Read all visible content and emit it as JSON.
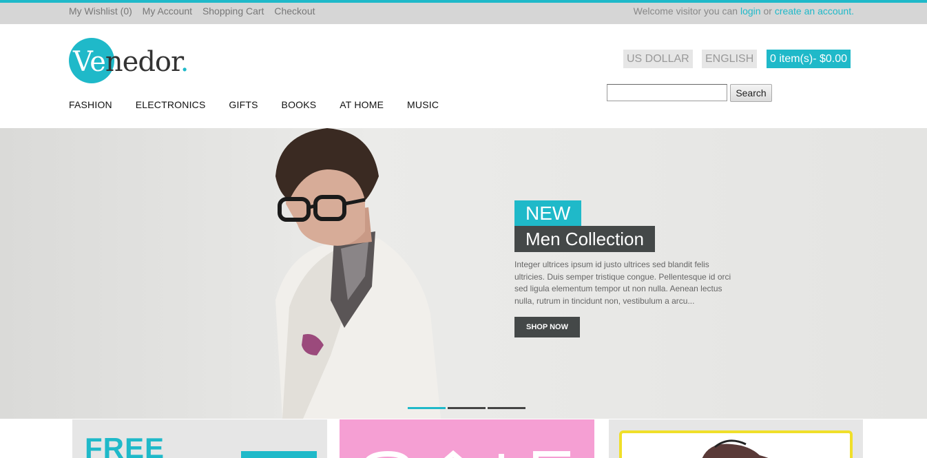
{
  "topbar": {
    "links": [
      "My Wishlist (0)",
      "My Account",
      "Shopping Cart",
      "Checkout"
    ],
    "welcome_prefix": "Welcome visitor you can ",
    "login_label": "login",
    "or_label": " or ",
    "create_label": "create an account."
  },
  "header": {
    "logo": {
      "ve": "Ve",
      "rest": "nedor",
      "dot": "."
    },
    "nav": [
      "FASHION",
      "ELECTRONICS",
      "GIFTS",
      "BOOKS",
      "AT HOME",
      "MUSIC"
    ],
    "currency": "US DOLLAR",
    "language": "ENGLISH",
    "cart": "0 item(s)- $0.00",
    "search": {
      "value": "",
      "button": "Search"
    }
  },
  "hero": {
    "badge": "NEW",
    "title": "Men Collection",
    "description": "Integer ultrices ipsum id justo ultrices sed blandit felis ultricies. Duis semper tristique congue. Pellentesque id orci sed ligula elementum tempor ut non nulla. Aenean lectus nulla, rutrum in tincidunt non, vestibulum a arcu...",
    "button": "SHOP NOW",
    "slides": 3,
    "active_slide": 1
  },
  "promos": {
    "free_text": "FREE"
  },
  "colors": {
    "accent": "#1fb9c9",
    "dark": "#444848",
    "topbar": "#d6d6d6",
    "sale_pink": "#f59fd3",
    "frame_yellow": "#f0df2a"
  }
}
